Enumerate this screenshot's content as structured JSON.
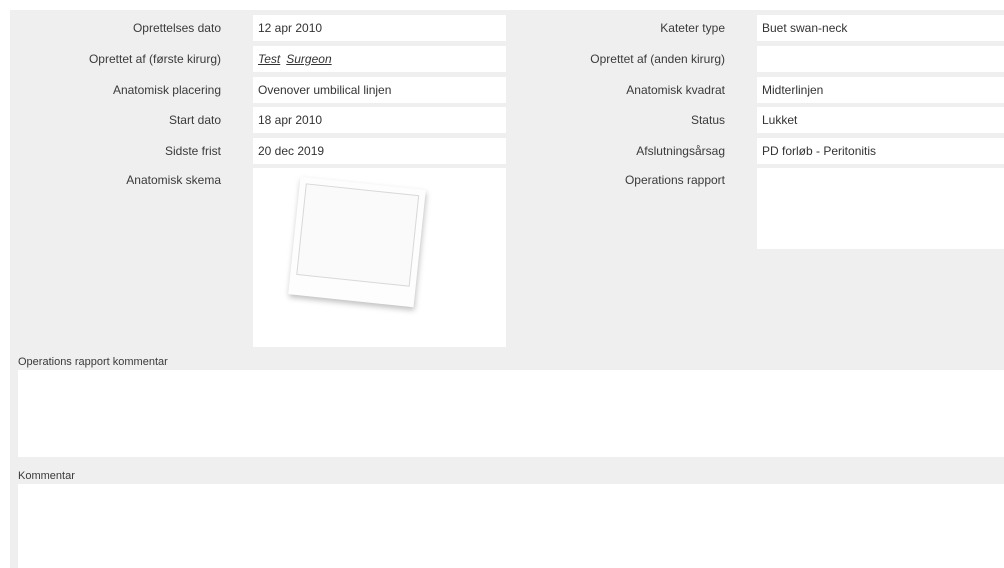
{
  "left": {
    "rows": [
      {
        "label": "Oprettelses dato",
        "value": "12 apr 2010"
      },
      {
        "label": "Oprettet af (første kirurg)",
        "links": [
          "Test",
          "Surgeon"
        ]
      },
      {
        "label": "Anatomisk placering",
        "value": "Ovenover umbilical linjen"
      },
      {
        "label": "Start dato",
        "value": "18 apr 2010"
      },
      {
        "label": "Sidste frist",
        "value": "20 dec 2019"
      },
      {
        "label": "Anatomisk skema"
      }
    ]
  },
  "right": {
    "rows": [
      {
        "label": "Kateter type",
        "value": "Buet swan-neck"
      },
      {
        "label": "Oprettet af (anden kirurg)",
        "value": ""
      },
      {
        "label": "Anatomisk kvadrat",
        "value": "Midterlinjen"
      },
      {
        "label": "Status",
        "value": "Lukket"
      },
      {
        "label": "Afslutningsårsag",
        "value": "PD forløb - Peritonitis"
      },
      {
        "label": "Operations rapport",
        "value": ""
      }
    ]
  },
  "sections": {
    "report_comment_label": "Operations rapport kommentar",
    "comment_label": "Kommentar"
  }
}
